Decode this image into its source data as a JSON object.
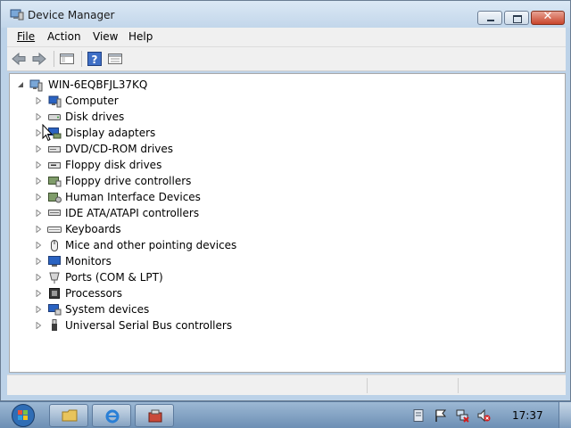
{
  "window": {
    "title": "Device Manager",
    "menu": [
      "File",
      "Action",
      "View",
      "Help"
    ]
  },
  "tree": {
    "root": "WIN-6EQBFJL37KQ",
    "items": [
      {
        "label": "Computer",
        "icon": "computer-icon"
      },
      {
        "label": "Disk drives",
        "icon": "disk-drive-icon"
      },
      {
        "label": "Display adapters",
        "icon": "display-adapter-icon"
      },
      {
        "label": "DVD/CD-ROM drives",
        "icon": "dvd-drive-icon"
      },
      {
        "label": "Floppy disk drives",
        "icon": "floppy-drive-icon"
      },
      {
        "label": "Floppy drive controllers",
        "icon": "floppy-controller-icon"
      },
      {
        "label": "Human Interface Devices",
        "icon": "hid-icon"
      },
      {
        "label": "IDE ATA/ATAPI controllers",
        "icon": "ide-controller-icon"
      },
      {
        "label": "Keyboards",
        "icon": "keyboard-icon"
      },
      {
        "label": "Mice and other pointing devices",
        "icon": "mouse-icon"
      },
      {
        "label": "Monitors",
        "icon": "monitor-icon"
      },
      {
        "label": "Ports (COM & LPT)",
        "icon": "port-icon"
      },
      {
        "label": "Processors",
        "icon": "processor-icon"
      },
      {
        "label": "System devices",
        "icon": "system-device-icon"
      },
      {
        "label": "Universal Serial Bus controllers",
        "icon": "usb-icon"
      }
    ]
  },
  "taskbar": {
    "clock": "17:37"
  }
}
